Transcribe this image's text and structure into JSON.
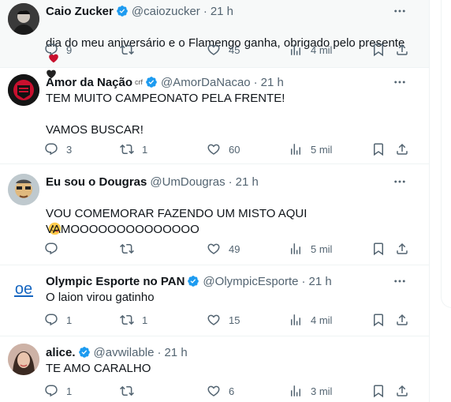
{
  "colors": {
    "verified": "#1d9bf0",
    "muted": "#536471",
    "red_heart": "#c8102e"
  },
  "tweets": [
    {
      "name": "Caio Zucker",
      "verified": true,
      "affiliate": "",
      "handle": "@caiozucker",
      "time": "21 h",
      "text": "dia do meu aniversário e o Flamengo ganha, obrigado pelo presente",
      "emojis": [
        "red-heart",
        "black-heart"
      ],
      "replies": "9",
      "retweets": "",
      "likes": "45",
      "views": "4 mil"
    },
    {
      "name": "Amor da Nação",
      "verified": true,
      "affiliate": "crf",
      "handle": "@AmorDaNacao",
      "time": "21 h",
      "text": "TEM MUITO CAMPEONATO PELA FRENTE!\n\nVAMOS BUSCAR!",
      "replies": "3",
      "retweets": "1",
      "likes": "60",
      "views": "5 mil"
    },
    {
      "name": "Eu sou o Dougras",
      "verified": false,
      "affiliate": "",
      "handle": "@UmDougras",
      "time": "21 h",
      "text": "VOU COMEMORAR FAZENDO UM MISTO AQUI",
      "text2": "VAMOOOOOOOOOOOOOO",
      "replies": "",
      "retweets": "",
      "likes": "49",
      "views": "5 mil"
    },
    {
      "name": "Olympic Esporte no PAN",
      "verified": true,
      "affiliate": "",
      "handle": "@OlympicEsporte",
      "time": "21 h",
      "text": "O laion virou gatinho",
      "avatar_text": "oe",
      "replies": "1",
      "retweets": "1",
      "likes": "15",
      "views": "4 mil"
    },
    {
      "name": "alice.",
      "verified": true,
      "affiliate": "",
      "handle": "@avwilable",
      "time": "21 h",
      "text": "TE AMO CARALHO",
      "replies": "1",
      "retweets": "",
      "likes": "6",
      "views": "3 mil"
    }
  ]
}
